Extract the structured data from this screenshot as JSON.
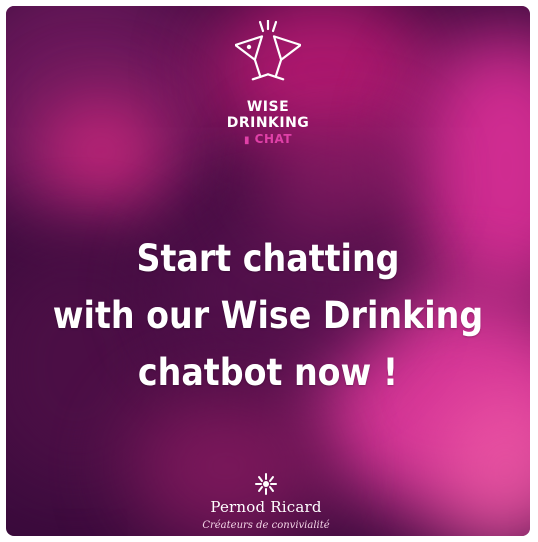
{
  "logo": {
    "icon": "toasting-cocktail-glasses-icon",
    "line1": "WISE",
    "line2": "DRINKING",
    "line3": "CHAT"
  },
  "headline": {
    "line1": "Start chatting",
    "line2": "with our Wise Drinking",
    "line3": "chatbot now !"
  },
  "brand": {
    "icon": "pernod-ricard-sun-icon",
    "name": "Pernod Ricard",
    "tagline": "Créateurs de convivialité"
  },
  "colors": {
    "background_dark": "#3a0b3c",
    "magenta": "#e0309a",
    "logo_accent": "#e040a8",
    "text": "#ffffff"
  }
}
